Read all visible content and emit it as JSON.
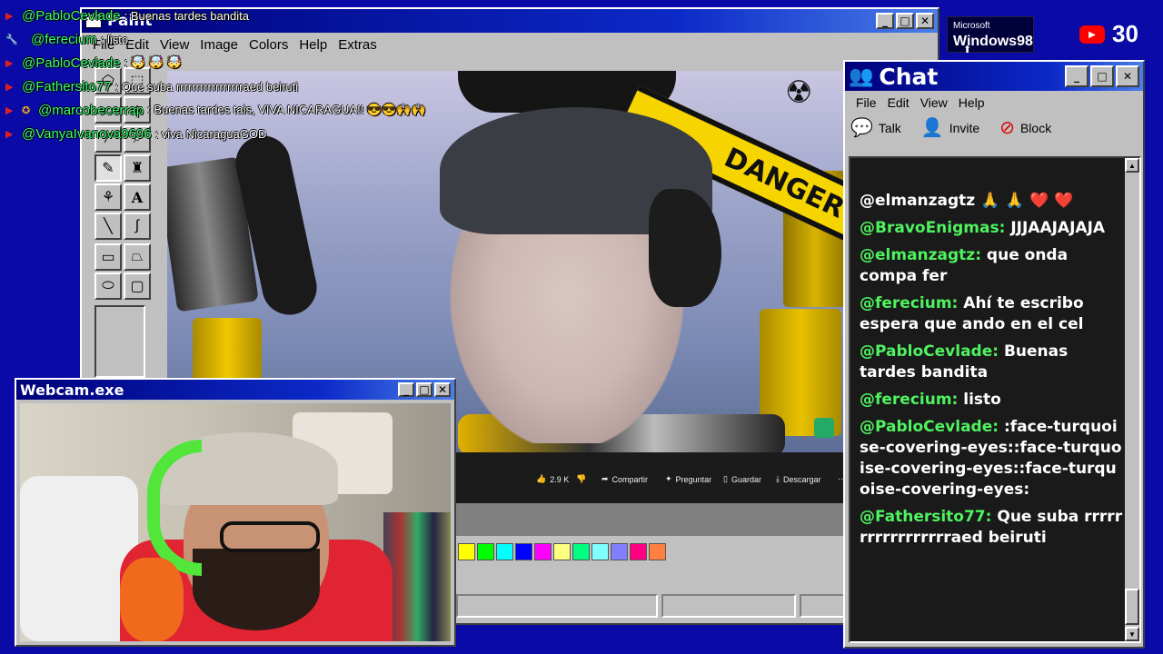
{
  "overlay_chat": [
    {
      "icon": "youtube-icon",
      "user": "@PabloCevlade",
      "msg": ": Buenas tardes bandita"
    },
    {
      "icon": "wrench-icon",
      "user": "@ferecium",
      "msg": ": listo"
    },
    {
      "icon": "youtube-icon",
      "user": "@PabloCevlade",
      "msg": ": 🤯 🤯 🤯"
    },
    {
      "icon": "youtube-icon",
      "user": "@Fathersito77",
      "msg": ": Que suba rrrrrrrrrrrrrrrrraed beiruti"
    },
    {
      "icon": "badge-icon",
      "user": "@marcobecerrap",
      "msg": ": Buenas tardes tais, VIVA NICARAGUA!! 😎😎🙌🙌"
    },
    {
      "icon": "youtube-icon",
      "user": "@VanyaIvanova9696",
      "msg": ": viva NicaraguaGOD"
    }
  ],
  "paint": {
    "title": "Paint",
    "menu": [
      "File",
      "Edit",
      "View",
      "Image",
      "Colors",
      "Help",
      "Extras"
    ],
    "video": {
      "danger_text": "DANGER",
      "likes": "2.9 K",
      "share": "Compartir",
      "ask": "Preguntar",
      "save": "Guardar",
      "download": "Descargar"
    },
    "palette": [
      "#ffff00",
      "#00ff00",
      "#00ffff",
      "#0000ff",
      "#ff00ff",
      "#ffff80",
      "#00ff80",
      "#80ffff",
      "#8080ff",
      "#ff0080",
      "#ff8040"
    ]
  },
  "chat": {
    "title": "Chat",
    "menu": [
      "File",
      "Edit",
      "View",
      "Help"
    ],
    "toolbar": {
      "talk": "Talk",
      "invite": "Invite",
      "block": "Block"
    },
    "messages": [
      {
        "user": "@elmanzagtz",
        "text": "🙏 🙏 ❤️ ❤️"
      },
      {
        "user": "@BravoEnigmas:",
        "text": "JJJAAJAJAJA"
      },
      {
        "user": "@elmanzagtz:",
        "text": "que onda compa fer"
      },
      {
        "user": "@ferecium:",
        "text": "Ahí te escribo espera que ando en el cel"
      },
      {
        "user": "@PabloCevlade:",
        "text": "Buenas tardes bandita"
      },
      {
        "user": "@ferecium:",
        "text": "listo"
      },
      {
        "user": "@PabloCevlade:",
        "text": ":face-turquoise-covering-eyes::face-turquoise-covering-eyes::face-turquoise-covering-eyes:"
      },
      {
        "user": "@Fathersito77:",
        "text": "Que suba rrrrrrrrrrrrrrrrraed beiruti"
      }
    ]
  },
  "webcam": {
    "title": "Webcam.exe"
  },
  "brand": {
    "microsoft": "Microsoft",
    "windows": "Windows98",
    "viewers": "30"
  }
}
